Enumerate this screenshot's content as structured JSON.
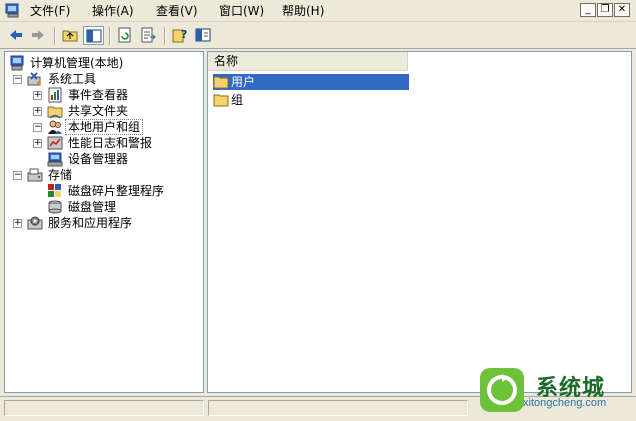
{
  "menu": {
    "items": [
      "文件(F)",
      "操作(A)",
      "查看(V)",
      "窗口(W)",
      "帮助(H)"
    ]
  },
  "window_controls": {
    "minimize": "_",
    "restore": "❐",
    "close": "✕"
  },
  "toolbar": {
    "buttons": [
      "back-icon",
      "forward-icon",
      "up-folder-icon",
      "show-hide-tree-icon",
      "refresh-icon",
      "export-list-icon",
      "help-icon",
      "properties-icon"
    ]
  },
  "tree": {
    "root": "计算机管理(本地)",
    "system_tools": "系统工具",
    "event_viewer": "事件查看器",
    "shared_folders": "共享文件夹",
    "local_users_groups": "本地用户和组",
    "perf_logs": "性能日志和警报",
    "device_manager": "设备管理器",
    "storage": "存储",
    "defrag": "磁盘碎片整理程序",
    "disk_mgmt": "磁盘管理",
    "services_apps": "服务和应用程序"
  },
  "list": {
    "column_name": "名称",
    "rows": [
      "用户",
      "组"
    ],
    "selected_row": "用户"
  },
  "watermark": {
    "text": "系统城",
    "url": "xitongcheng.com"
  },
  "colors": {
    "selection": "#316ac5",
    "pane_border": "#7f9db9",
    "chrome": "#ece9d8"
  }
}
